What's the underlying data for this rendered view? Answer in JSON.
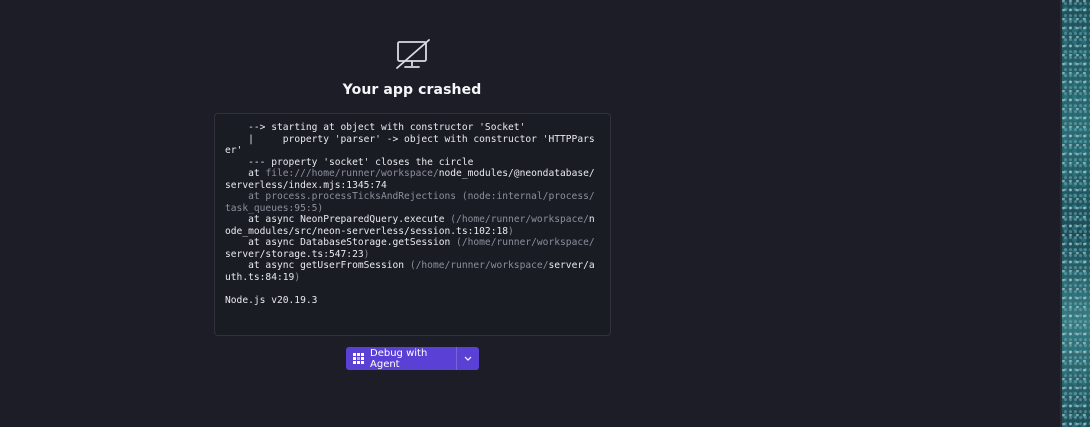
{
  "crash": {
    "icon": "monitor-off-icon",
    "title": "Your app crashed"
  },
  "log": {
    "lines": [
      [
        {
          "t": "    --> starting at object with constructor 'Socket'",
          "c": "bright"
        }
      ],
      [
        {
          "t": "    |     property 'parser' -> object with constructor 'HTTPParser'",
          "c": "bright"
        }
      ],
      [
        {
          "t": "    --- property 'socket' closes the circle",
          "c": "bright"
        }
      ],
      [
        {
          "t": "    at ",
          "c": "bright"
        },
        {
          "t": "file:///home/runner/workspace/",
          "c": "dim"
        },
        {
          "t": "node_modules/@neondatabase/serverless/index.mjs:1345:74",
          "c": "bright"
        }
      ],
      [
        {
          "t": "    at process.processTicksAndRejections (node:internal/process/task_queues:95:5)",
          "c": "dim"
        }
      ],
      [
        {
          "t": "    at async NeonPreparedQuery.execute ",
          "c": "bright"
        },
        {
          "t": "(/home/runner/workspace/",
          "c": "dim"
        },
        {
          "t": "node_modules/src/neon-serverless/session.ts:102:18",
          "c": "bright"
        },
        {
          "t": ")",
          "c": "dim"
        }
      ],
      [
        {
          "t": "    at async DatabaseStorage.getSession ",
          "c": "bright"
        },
        {
          "t": "(/home/runner/workspace/",
          "c": "dim"
        },
        {
          "t": "server/storage.ts:547:23",
          "c": "bright"
        },
        {
          "t": ")",
          "c": "dim"
        }
      ],
      [
        {
          "t": "    at async getUserFromSession ",
          "c": "bright"
        },
        {
          "t": "(/home/runner/workspace/",
          "c": "dim"
        },
        {
          "t": "server/auth.ts:84:19",
          "c": "bright"
        },
        {
          "t": ")",
          "c": "dim"
        }
      ],
      [],
      [
        {
          "t": "Node.js v20.19.3",
          "c": "bright"
        }
      ]
    ]
  },
  "debug_button": {
    "icon": "grid-agent-icon",
    "label": "Debug with Agent",
    "dropdown_icon": "chevron-down-icon",
    "color": "#5b40d6"
  }
}
